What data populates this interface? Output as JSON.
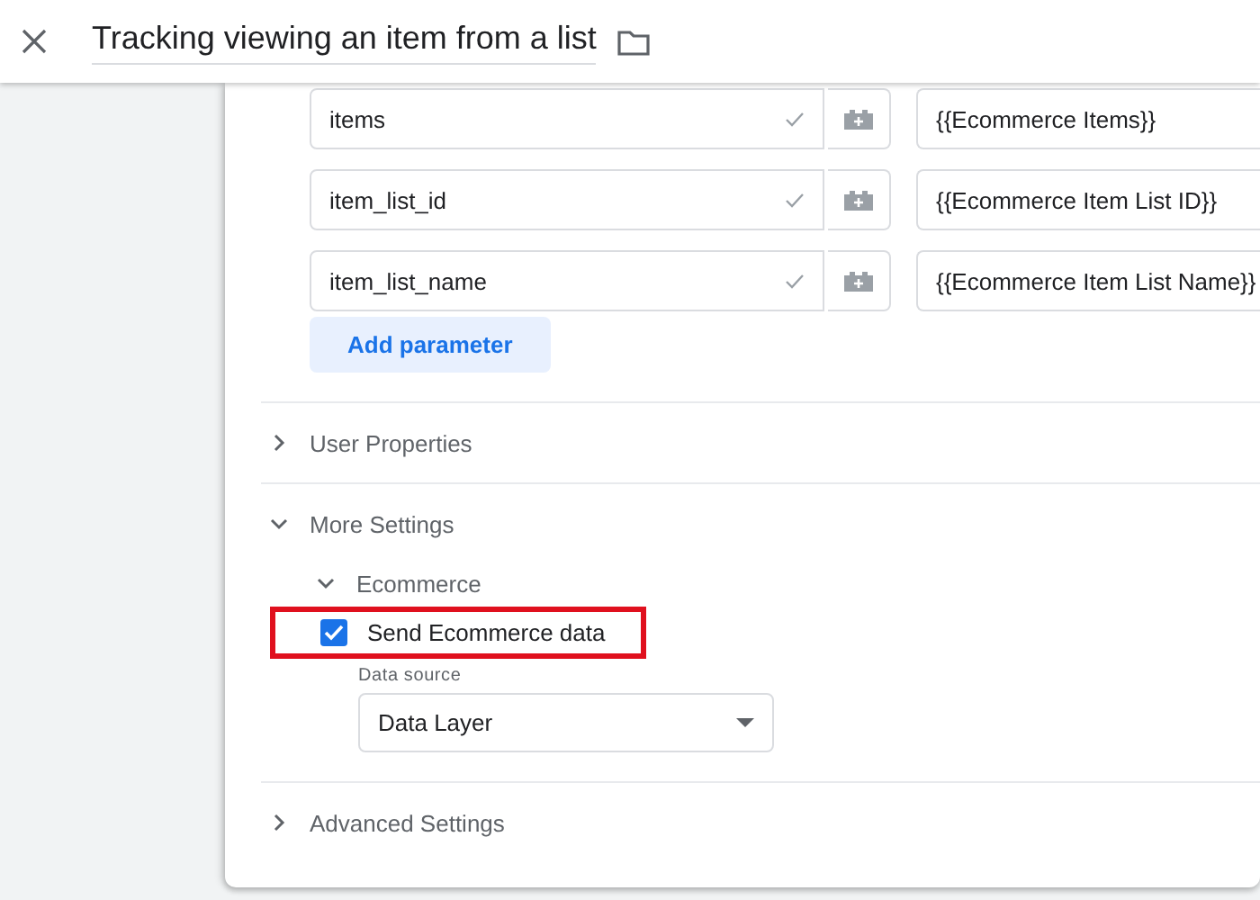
{
  "header": {
    "title": "Tracking viewing an item from a list"
  },
  "parameters": [
    {
      "name": "items",
      "value": "{{Ecommerce Items}}"
    },
    {
      "name": "item_list_id",
      "value": "{{Ecommerce Item List ID}}"
    },
    {
      "name": "item_list_name",
      "value": "{{Ecommerce Item List Name}}"
    }
  ],
  "add_parameter": "Add parameter",
  "sections": [
    {
      "label": "User Properties",
      "expanded": false
    },
    {
      "label": "More Settings",
      "expanded": true,
      "children": [
        {
          "label": "Ecommerce",
          "expanded": true,
          "checkbox": {
            "label": "Send Ecommerce data",
            "checked": true,
            "highlighted": true
          },
          "data_source": {
            "label": "Data source",
            "value": "Data Layer"
          }
        }
      ]
    },
    {
      "label": "Advanced Settings",
      "expanded": false
    }
  ]
}
